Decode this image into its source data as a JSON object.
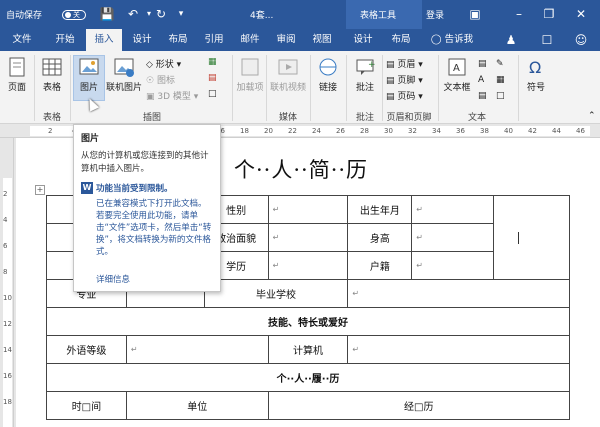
{
  "title_bar": {
    "autosave_label": "自动保存",
    "autosave_state": "关",
    "doc_name": "4套...",
    "context_tab": "表格工具",
    "login": "登录",
    "icons": [
      "save-icon",
      "undo-icon",
      "redo-icon",
      "customize-icon",
      "ribbon-options-icon",
      "minimize-icon",
      "restore-icon",
      "close-icon"
    ]
  },
  "tabs": [
    {
      "label": "文件"
    },
    {
      "label": "开始"
    },
    {
      "label": "插入"
    },
    {
      "label": "设计"
    },
    {
      "label": "布局"
    },
    {
      "label": "引用"
    },
    {
      "label": "邮件"
    },
    {
      "label": "审阅"
    },
    {
      "label": "视图"
    },
    {
      "label": "设计"
    },
    {
      "label": "布局"
    },
    {
      "label": "告诉我"
    }
  ],
  "ribbon": {
    "page": "页面",
    "table": "表格",
    "picture": "图片",
    "online_picture": "联机图片",
    "shapes": "形状",
    "icons": "图标",
    "model3d": "3D 模型",
    "addins": "加载项",
    "online_video": "联机视频",
    "link": "链接",
    "comment": "批注",
    "header": "页眉",
    "footer": "页脚",
    "page_number": "页码",
    "textbox": "文本框",
    "symbol": "符号",
    "groups": {
      "table": "表格",
      "illustrations": "插图",
      "media": "媒体",
      "comments": "批注",
      "header_footer": "页眉和页脚",
      "text": "文本"
    }
  },
  "ruler": {
    "numbers": [
      "2",
      "4",
      "6",
      "8",
      "10",
      "12",
      "14",
      "16",
      "18",
      "20",
      "22",
      "24",
      "26",
      "28",
      "30",
      "32",
      "34",
      "36",
      "38",
      "40",
      "42",
      "44",
      "46"
    ]
  },
  "vruler": {
    "numbers": [
      "2",
      "4",
      "6",
      "8",
      "10",
      "12",
      "14",
      "16",
      "18"
    ]
  },
  "tooltip": {
    "title": "图片",
    "desc": "从您的计算机或您连接到的其他计算机中插入图片。",
    "warn_head": "功能当前受到限制。",
    "warn_body": "已在兼容模式下打开此文档。若要完全使用此功能，请单击“文件”选项卡，然后单击“转换”，将文档转换为新的文件格式。",
    "more": "详细信息"
  },
  "document": {
    "title": "个··人··简··历",
    "rows": {
      "gender": "性别",
      "birth": "出生年月",
      "political": "政治面貌",
      "height": "身高",
      "education": "学历",
      "huji": "户籍",
      "major": "专业",
      "school": "毕业学校",
      "skills": "技能、特长或爱好",
      "foreign_lang": "外语等级",
      "computer": "计算机",
      "resume_head": "个··人··履··历",
      "time": "时□间",
      "unit": "单位",
      "experience": "经□历"
    },
    "para_mark": "↵"
  }
}
